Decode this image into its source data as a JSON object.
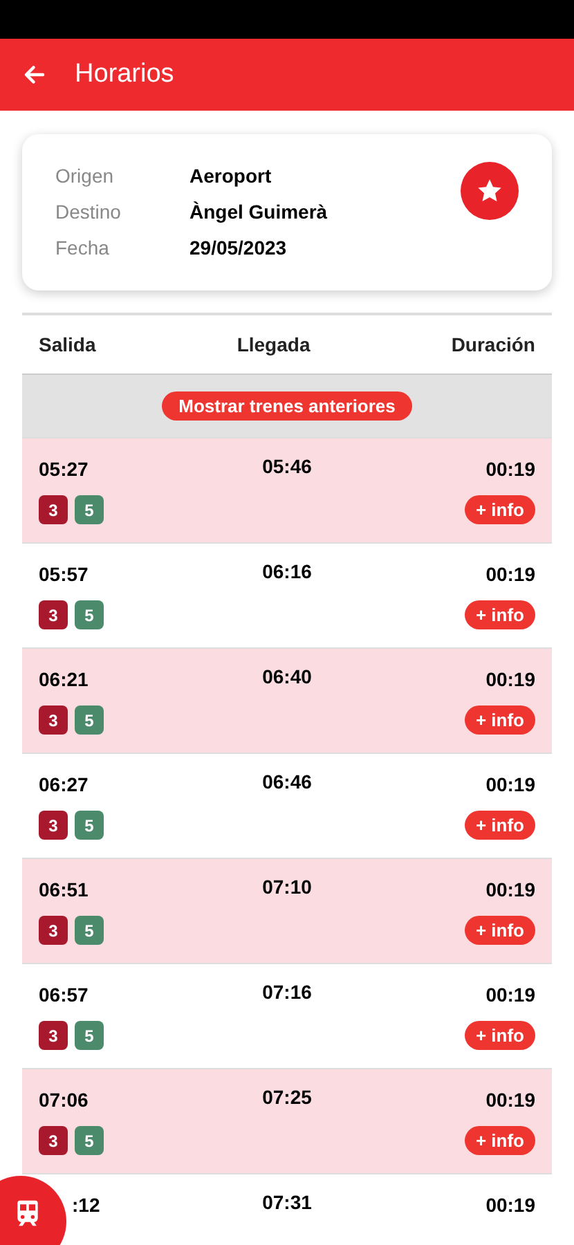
{
  "header": {
    "title": "Horarios"
  },
  "trip": {
    "fields": [
      {
        "label": "Origen",
        "value": "Aeroport"
      },
      {
        "label": "Destino",
        "value": "Àngel Guimerà"
      },
      {
        "label": "Fecha",
        "value": "29/05/2023"
      }
    ],
    "favorite": true
  },
  "table": {
    "columns": [
      "Salida",
      "Llegada",
      "Duración"
    ],
    "earlier_button": "Mostrar trenes anteriores",
    "rows": [
      {
        "departure": "05:27",
        "arrival": "05:46",
        "duration": "00:19",
        "highlighted": true,
        "lines": [
          {
            "label": "3",
            "color": "#a8192e"
          },
          {
            "label": "5",
            "color": "#4b8b6b"
          }
        ],
        "info": "+ info"
      },
      {
        "departure": "05:57",
        "arrival": "06:16",
        "duration": "00:19",
        "highlighted": false,
        "lines": [
          {
            "label": "3",
            "color": "#a8192e"
          },
          {
            "label": "5",
            "color": "#4b8b6b"
          }
        ],
        "info": "+ info"
      },
      {
        "departure": "06:21",
        "arrival": "06:40",
        "duration": "00:19",
        "highlighted": true,
        "lines": [
          {
            "label": "3",
            "color": "#a8192e"
          },
          {
            "label": "5",
            "color": "#4b8b6b"
          }
        ],
        "info": "+ info"
      },
      {
        "departure": "06:27",
        "arrival": "06:46",
        "duration": "00:19",
        "highlighted": false,
        "lines": [
          {
            "label": "3",
            "color": "#a8192e"
          },
          {
            "label": "5",
            "color": "#4b8b6b"
          }
        ],
        "info": "+ info"
      },
      {
        "departure": "06:51",
        "arrival": "07:10",
        "duration": "00:19",
        "highlighted": true,
        "lines": [
          {
            "label": "3",
            "color": "#a8192e"
          },
          {
            "label": "5",
            "color": "#4b8b6b"
          }
        ],
        "info": "+ info"
      },
      {
        "departure": "06:57",
        "arrival": "07:16",
        "duration": "00:19",
        "highlighted": false,
        "lines": [
          {
            "label": "3",
            "color": "#a8192e"
          },
          {
            "label": "5",
            "color": "#4b8b6b"
          }
        ],
        "info": "+ info"
      },
      {
        "departure": "07:06",
        "arrival": "07:25",
        "duration": "00:19",
        "highlighted": true,
        "lines": [
          {
            "label": "3",
            "color": "#a8192e"
          },
          {
            "label": "5",
            "color": "#4b8b6b"
          }
        ],
        "info": "+ info"
      },
      {
        "departure": ":12",
        "arrival": "07:31",
        "duration": "00:19",
        "highlighted": false
      }
    ]
  }
}
